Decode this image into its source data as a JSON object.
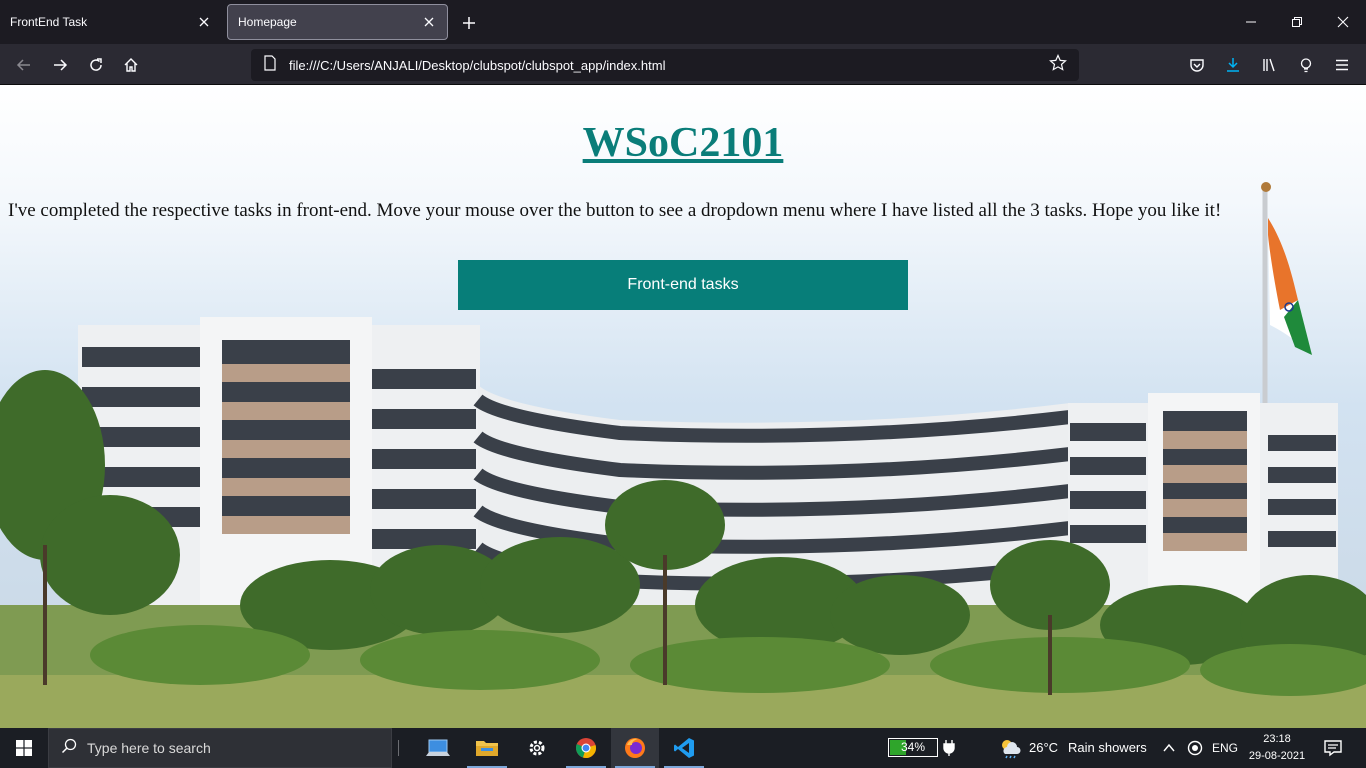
{
  "browser": {
    "tabs": [
      {
        "title": "FrontEnd Task",
        "active": false
      },
      {
        "title": "Homepage",
        "active": true
      }
    ],
    "new_tab_symbol": "+",
    "close_symbol": "✕",
    "url": "file:///C:/Users/ANJALI/Desktop/clubspot/clubspot_app/index.html"
  },
  "page": {
    "title": "WSoC2101",
    "description": "I've completed the respective tasks in front-end. Move your mouse over the button to see a dropdown menu where I have listed all the 3 tasks. Hope you like it!",
    "button_label": "Front-end tasks",
    "colors": {
      "accent": "#077e79",
      "title": "#0a7d79"
    }
  },
  "taskbar": {
    "search_placeholder": "Type here to search",
    "apps": [
      "laptop-icon",
      "file-explorer-icon",
      "settings-icon",
      "chrome-icon",
      "firefox-icon",
      "vscode-icon"
    ],
    "battery_percent": "34%",
    "battery_level": 0.34,
    "weather_temp": "26°C",
    "weather_desc": "Rain showers",
    "language": "ENG",
    "time": "23:18",
    "date": "29-08-2021"
  }
}
